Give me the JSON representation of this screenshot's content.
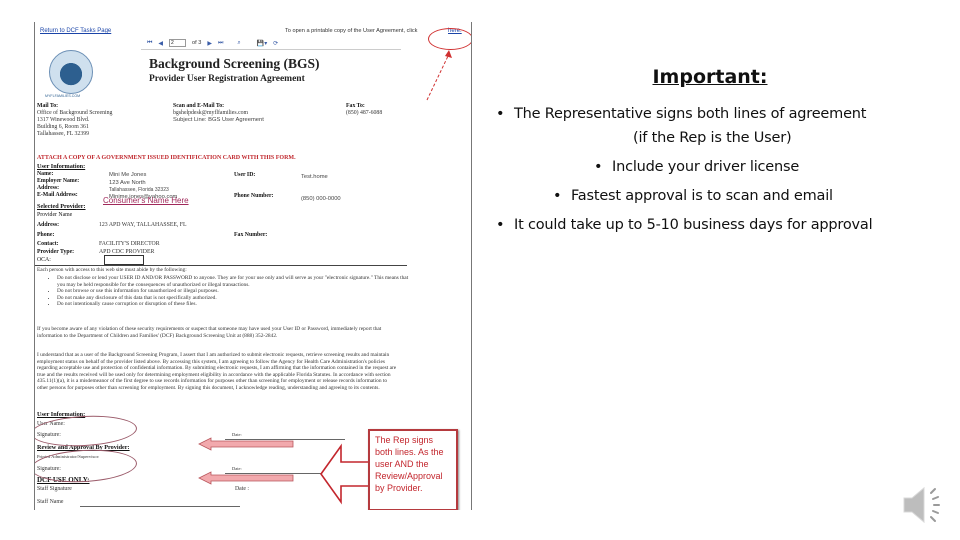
{
  "form": {
    "return_link": "Return to DCF Tasks Page",
    "printable_note": "To open a printable copy of the User Agreement, click",
    "printable_link": "here.",
    "toolbar": {
      "icons": [
        "first-page-icon",
        "previous-page-icon",
        "page-number-input",
        "next-page-icon",
        "last-page-icon",
        "find-icon",
        "export-icon",
        "refresh-icon"
      ],
      "page_value": "2",
      "page_of": "of 3"
    },
    "logo_caption": "MYFLFAMILIES.COM",
    "title": "Background Screening (BGS)",
    "subtitle": "Provider User Registration Agreement",
    "mail_to": {
      "label": "Mail To:",
      "lines": [
        "Office of Background Screening",
        "1317 Winewood Blvd.",
        "Building 6, Room 361",
        "Tallahassee, FL 32399"
      ]
    },
    "scan_email": {
      "label": "Scan and E-Mail To:",
      "lines": [
        "bgshelpdesk@myflfamilies.com",
        "Subject Line: BGS User Agreement"
      ]
    },
    "fax": {
      "label": "Fax To:",
      "lines": [
        "(850) 487-6088"
      ]
    },
    "attach_notice": "ATTACH A COPY OF A GOVERNMENT ISSUED IDENTIFICATION CARD WITH THIS FORM.",
    "user_info": {
      "heading": "User Information:",
      "name_label": "Name:",
      "name_value": "Mini Me Jones",
      "employer_label": "Employer Name:",
      "address_label": "Address:",
      "address_line1": "123 Ave North",
      "address_line2": "Tallahassee, Florida 32323",
      "email_label": "E-Mail Address:",
      "email_value": "Minime.jones@yahoo.com",
      "userid_label": "User ID:",
      "userid_value": "Test.home",
      "phone_label": "Phone Number:",
      "phone_value": "(850) 000-0000"
    },
    "provider": {
      "heading": "Selected Provider:",
      "name_label": "Provider Name",
      "name_value": "Consumer's Name Here",
      "address_label": "Address:",
      "address_value": "123 APD WAY,   TALLAHASSEE, FL",
      "phone_label": "Phone:",
      "fax_label": "Fax Number:",
      "contact_label": "Contact:",
      "contact_value": "FACILITY'S DIRECTOR",
      "type_label": "Provider Type:",
      "type_value": "APD CDC PROVIDER",
      "oca_label": "OCA:",
      "oca_value": ""
    },
    "rules_intro": "Each person with access to this web site must abide by the following:",
    "rules": [
      "Do not disclose or lend your USER ID AND/OR PASSWORD to anyone. They are for your use only and will serve as your \"electronic signature.\" This means that you may be held responsible for the consequences of unauthorized or illegal transactions.",
      "Do not browse or use this information for unauthorized or illegal purposes.",
      "Do not make any disclosure of this data that is not specifically authorized.",
      "Do not intentionally cause corruption or disruption of these files."
    ],
    "violation_text": "If you become aware of any violation of these security requirements or suspect that someone may have used your User ID or Password, immediately report that information to the Department of Children and Families' (DCF) Background Screening Unit at (888) 352-2842.",
    "agreement_text": "I understand that as a user of the Background Screening Program, I assert that I am authorized to submit electronic requests, retrieve screening results and maintain employment status on behalf of the provider listed above. By accessing this system, I am agreeing to follow the Agency for Health Care Administration's policies regarding acceptable use and protection of confidential information. By submitting electronic requests, I am affirming that the information contained in the request are true and the results received will be used only for determining employment eligibility in accordance with the applicable Florida Statutes. In accordance with section 435.11(1)(a), it is a misdemeanor of the first degree to use records information for purposes other than screening for employment or release records information to other persons for purposes other than screening for employment. By signing this document, I acknowledge reading, understanding and agreeing to its contents.",
    "signature_user": {
      "heading": "User Information:",
      "name_label": "User Name:",
      "signature_label": "Signature:",
      "date_label": "Date:"
    },
    "signature_provider": {
      "heading": "Review and Approval By Provider:",
      "name_label": "Printed Administrator/Supervisor:",
      "signature_label": "Signature:",
      "date_label": "Date:"
    },
    "dcf_use": {
      "heading": "DCF USE ONLY:",
      "staff_signature_label": "Staff Signature",
      "date_label": "Date :",
      "staff_name_label": "Staff Name"
    },
    "callout_text": "The Rep signs both lines. As the user AND the Review/Approval by Provider."
  },
  "notes": {
    "heading": "Important:",
    "items": [
      "The Representative signs both lines of agreement",
      "(if the Rep is the User)",
      "Include your driver license",
      "Fastest approval is to scan and email",
      "It could take up to 5-10 business days for approval"
    ]
  },
  "colors": {
    "annotation_red": "#c3262d",
    "link_blue": "#1a44a8",
    "consumer_name": "#a0285a",
    "arrow_pink": "#f2a9ad"
  },
  "audio": {
    "icon": "speaker-icon"
  }
}
